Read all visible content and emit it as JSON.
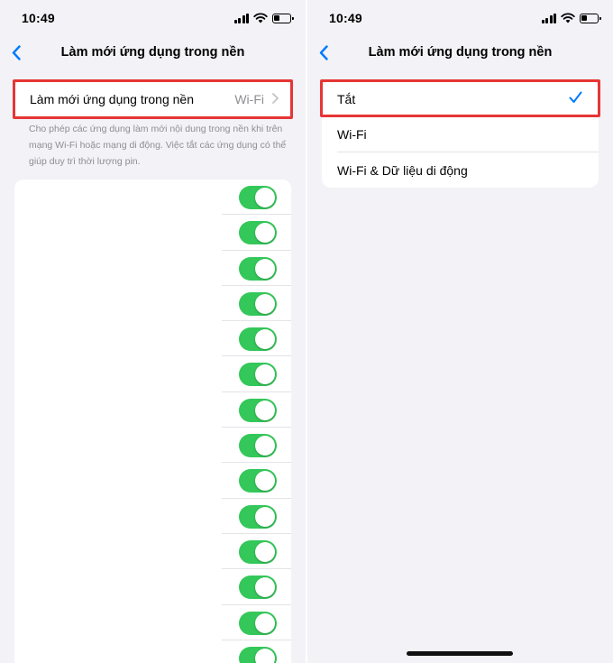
{
  "left": {
    "status_time": "10:49",
    "nav_title": "Làm mới ứng dụng trong nền",
    "setting": {
      "label": "Làm mới ứng dụng trong nền",
      "value": "Wi-Fi"
    },
    "footnote": "Cho phép các ứng dụng làm mới nội dung trong nền khi trên mạng Wi-Fi hoặc mạng di động. Việc tắt các ứng dụng có thể giúp duy trì thời lượng pin.",
    "toggles": [
      true,
      true,
      true,
      true,
      true,
      true,
      true,
      true,
      true,
      true,
      true,
      true,
      true,
      true
    ]
  },
  "right": {
    "status_time": "10:49",
    "nav_title": "Làm mới ứng dụng trong nền",
    "options": [
      {
        "label": "Tắt",
        "selected": true
      },
      {
        "label": "Wi-Fi",
        "selected": false
      },
      {
        "label": "Wi-Fi & Dữ liệu di động",
        "selected": false
      }
    ]
  },
  "colors": {
    "accent": "#007aff",
    "toggle_on": "#34c759",
    "highlight": "#e63535",
    "background": "#f2f2f7"
  },
  "icons": [
    "back-chevron-icon",
    "chevron-right-icon",
    "checkmark-icon",
    "signal-icon",
    "wifi-icon",
    "battery-icon"
  ]
}
